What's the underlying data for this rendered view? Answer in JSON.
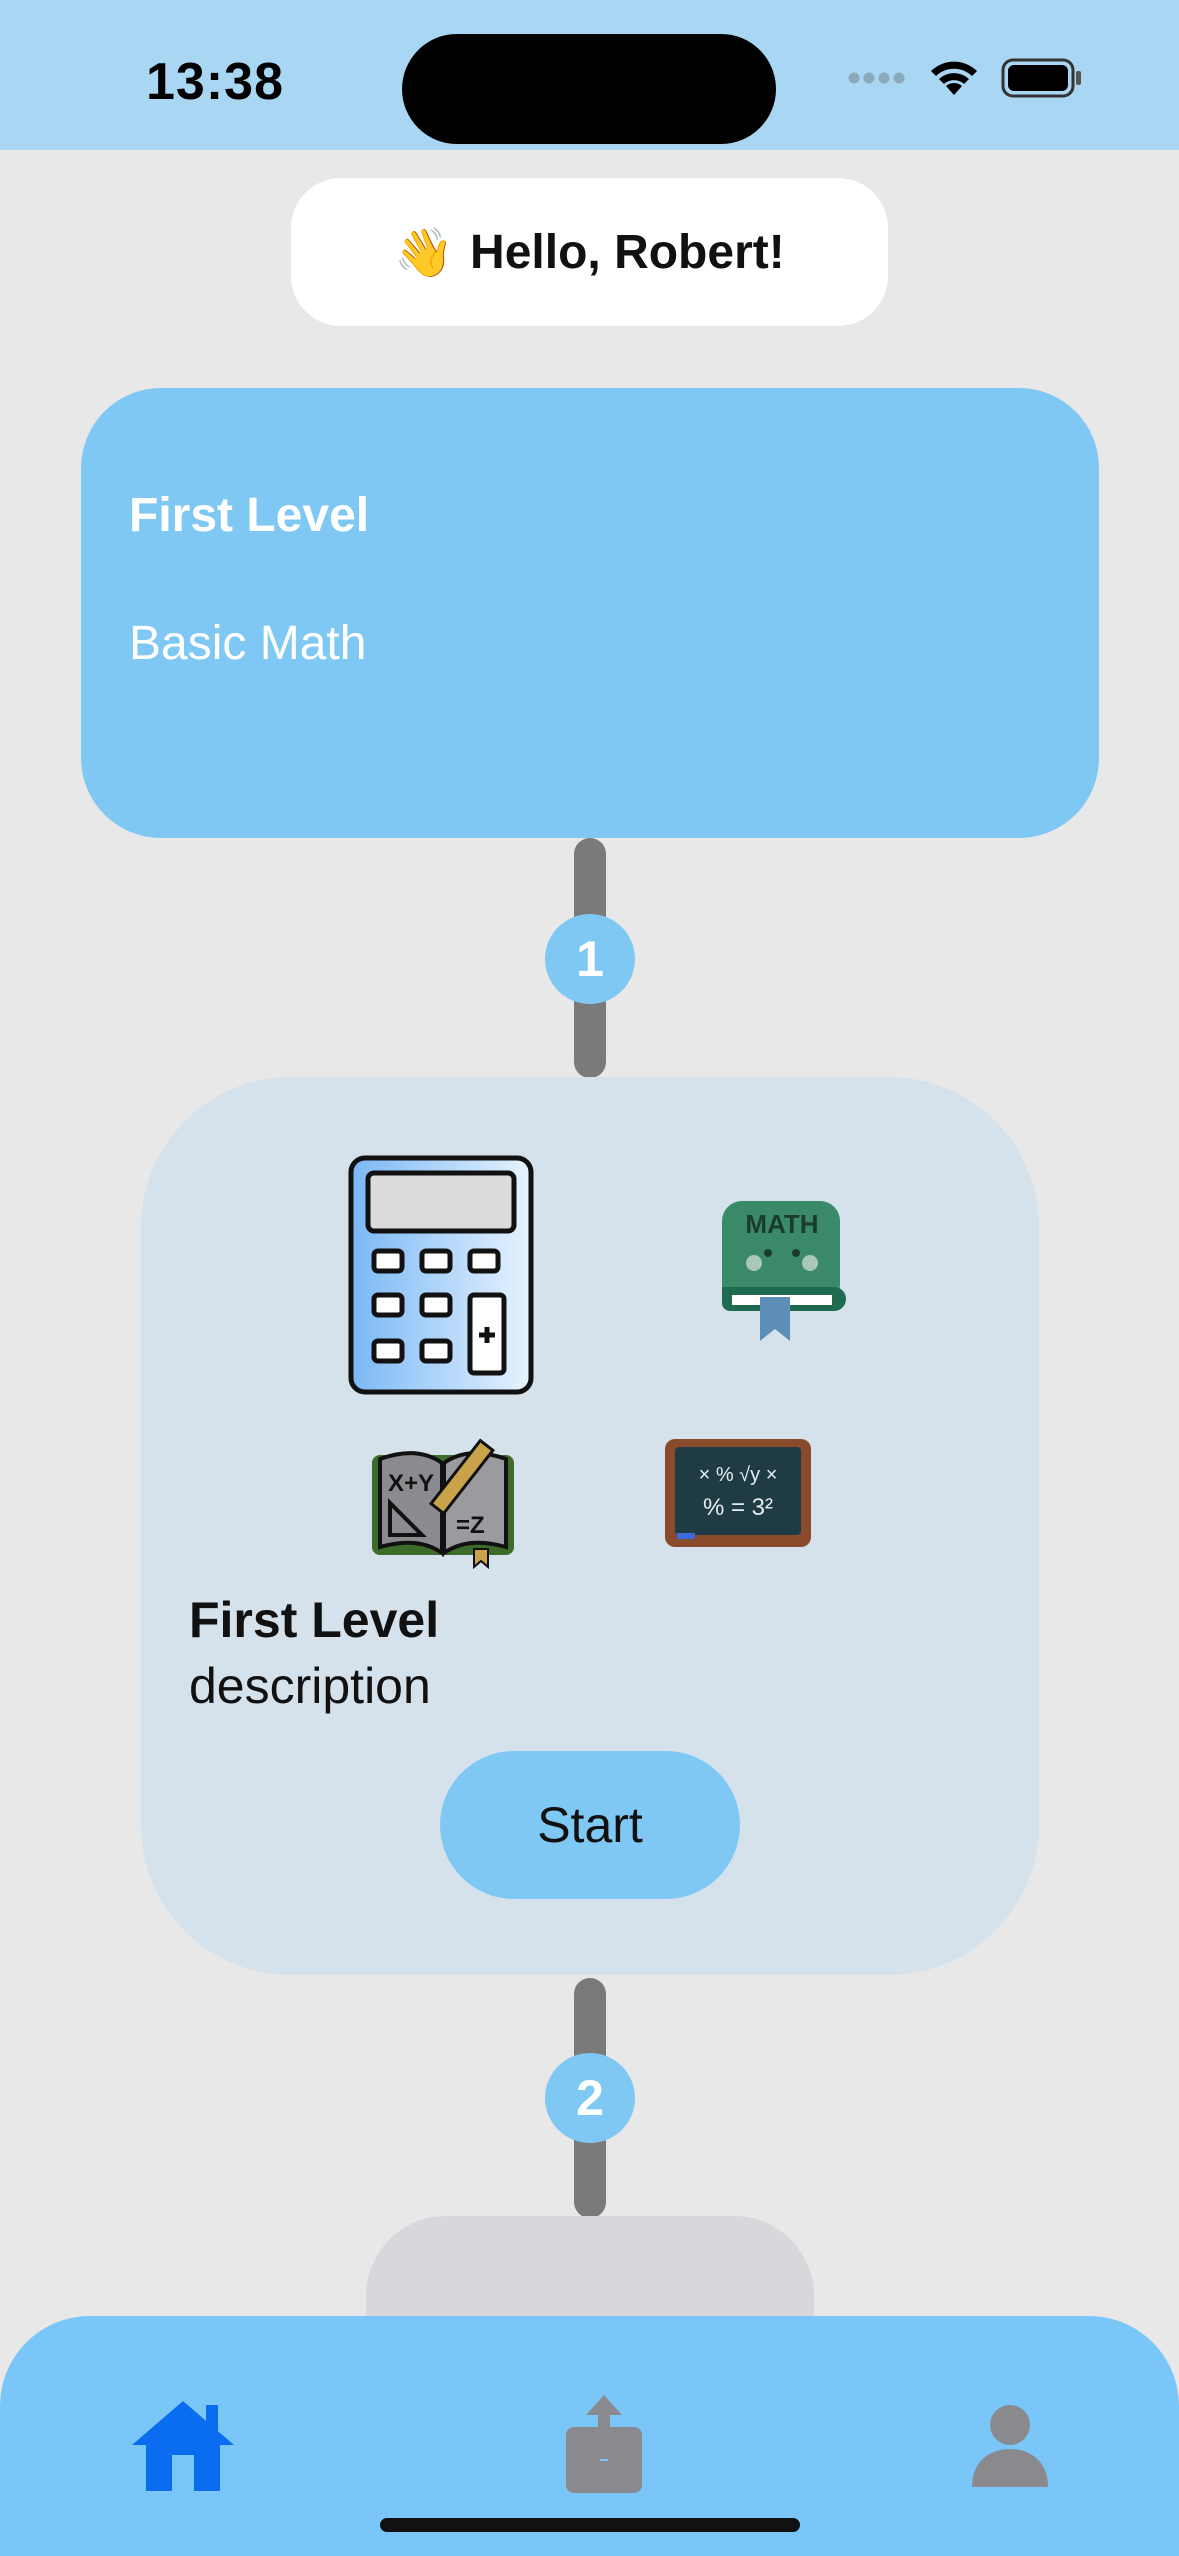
{
  "status_bar": {
    "time": "13:38"
  },
  "greeting": {
    "emoji": "👋",
    "text": "Hello, Robert!"
  },
  "level_card": {
    "title": "First Level",
    "subtitle": "Basic Math"
  },
  "steps": [
    {
      "number": "1"
    },
    {
      "number": "2"
    }
  ],
  "detail_card": {
    "title": "First Level",
    "description": "description",
    "start_label": "Start",
    "icons": [
      "calculator-icon",
      "math-book-icon",
      "geometry-book-icon",
      "chalkboard-icon"
    ],
    "book_label": "MATH",
    "geometry_text_a": "X+Y",
    "geometry_text_b": "=Z",
    "board_text_a": "× % √y ×",
    "board_text_b": "% = 3²"
  },
  "tabbar": {
    "items": [
      "home-icon",
      "share-icon",
      "profile-icon"
    ],
    "active": "home-icon",
    "active_color": "#0a6cf0",
    "inactive_color": "#8a8a8e"
  },
  "colors": {
    "accent": "#80c8f4",
    "background": "#e8e8e8",
    "card": "#d5e2ec"
  }
}
